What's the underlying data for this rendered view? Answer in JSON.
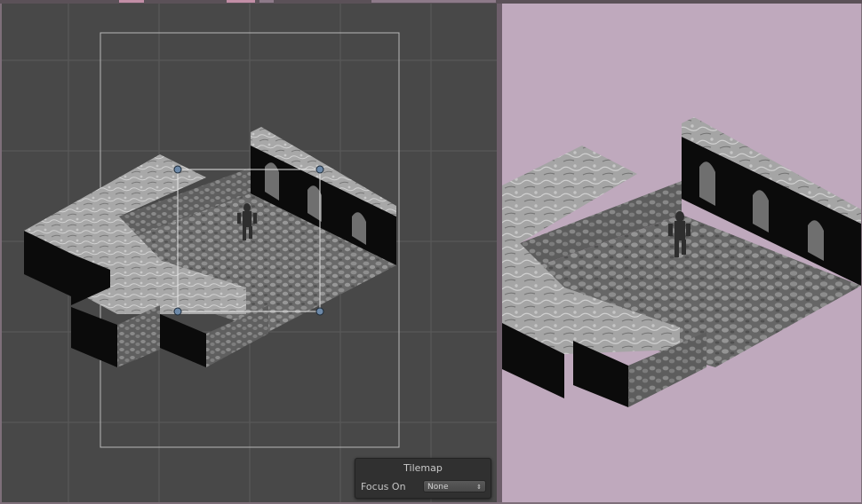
{
  "scene_overlay": {
    "title": "Tilemap",
    "focus_label": "Focus On",
    "focus_value": "None",
    "focus_arrows": "⇕"
  },
  "colors": {
    "scene_bg": "#484848",
    "grid": "#5b5b5b",
    "game_bg": "#bfa9bd",
    "stone_top": "#a9a9a9",
    "wall_dark": "#0b0b0b",
    "wall_light": "#6f6f6f"
  }
}
